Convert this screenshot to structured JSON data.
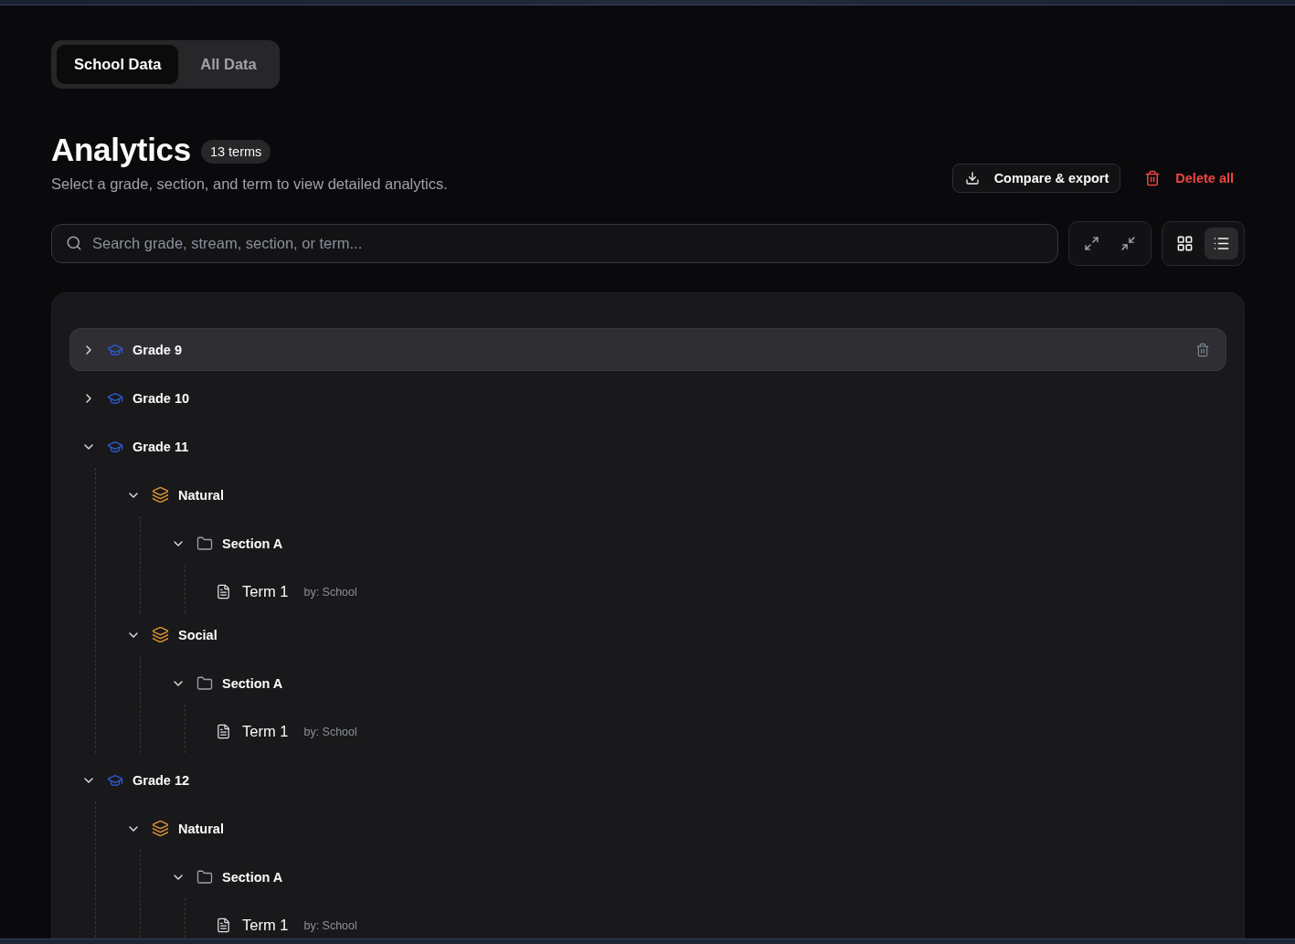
{
  "mode_tabs": [
    {
      "label": "School Data",
      "selected": true
    },
    {
      "label": "All Data",
      "selected": false
    }
  ],
  "header": {
    "title": "Analytics",
    "badge": "13 terms",
    "subtitle": "Select a grade, section, and term to view detailed analytics."
  },
  "actions": [
    {
      "kind": "export",
      "label": "Compare & export"
    },
    {
      "kind": "delete",
      "label": "Delete all"
    }
  ],
  "search": {
    "placeholder": "Search grade, stream, section, or term..."
  },
  "tree_controls": [
    {
      "kind": "expand"
    },
    {
      "kind": "collapse"
    }
  ],
  "view_toggle": [
    {
      "kind": "grid",
      "selected": false
    },
    {
      "kind": "list",
      "selected": true
    }
  ],
  "tree": [
    {
      "kind": "grade",
      "label": "Grade 9",
      "expanded": false,
      "highlighted": true
    },
    {
      "kind": "grade",
      "label": "Grade 10",
      "expanded": false,
      "highlighted": false
    },
    {
      "kind": "grade",
      "label": "Grade 11",
      "expanded": true,
      "highlighted": false,
      "children": [
        {
          "kind": "stream",
          "label": "Natural",
          "expanded": true,
          "highlighted": false,
          "children": [
            {
              "kind": "section",
              "label": "Section A",
              "expanded": true,
              "highlighted": false,
              "children": [
                {
                  "kind": "term",
                  "label": "Term 1",
                  "author": "by: School",
                  "highlighted": false
                }
              ]
            }
          ]
        },
        {
          "kind": "stream",
          "label": "Social",
          "expanded": true,
          "highlighted": false,
          "children": [
            {
              "kind": "section",
              "label": "Section A",
              "expanded": true,
              "highlighted": false,
              "children": [
                {
                  "kind": "term",
                  "label": "Term 1",
                  "author": "by: School",
                  "highlighted": false
                }
              ]
            }
          ]
        }
      ]
    },
    {
      "kind": "grade",
      "label": "Grade 12",
      "expanded": true,
      "highlighted": false,
      "children": [
        {
          "kind": "stream",
          "label": "Natural",
          "expanded": true,
          "highlighted": false,
          "children": [
            {
              "kind": "section",
              "label": "Section A",
              "expanded": true,
              "highlighted": false,
              "children": [
                {
                  "kind": "term",
                  "label": "Term 1",
                  "author": "by: School",
                  "highlighted": false
                }
              ]
            }
          ]
        }
      ]
    }
  ]
}
